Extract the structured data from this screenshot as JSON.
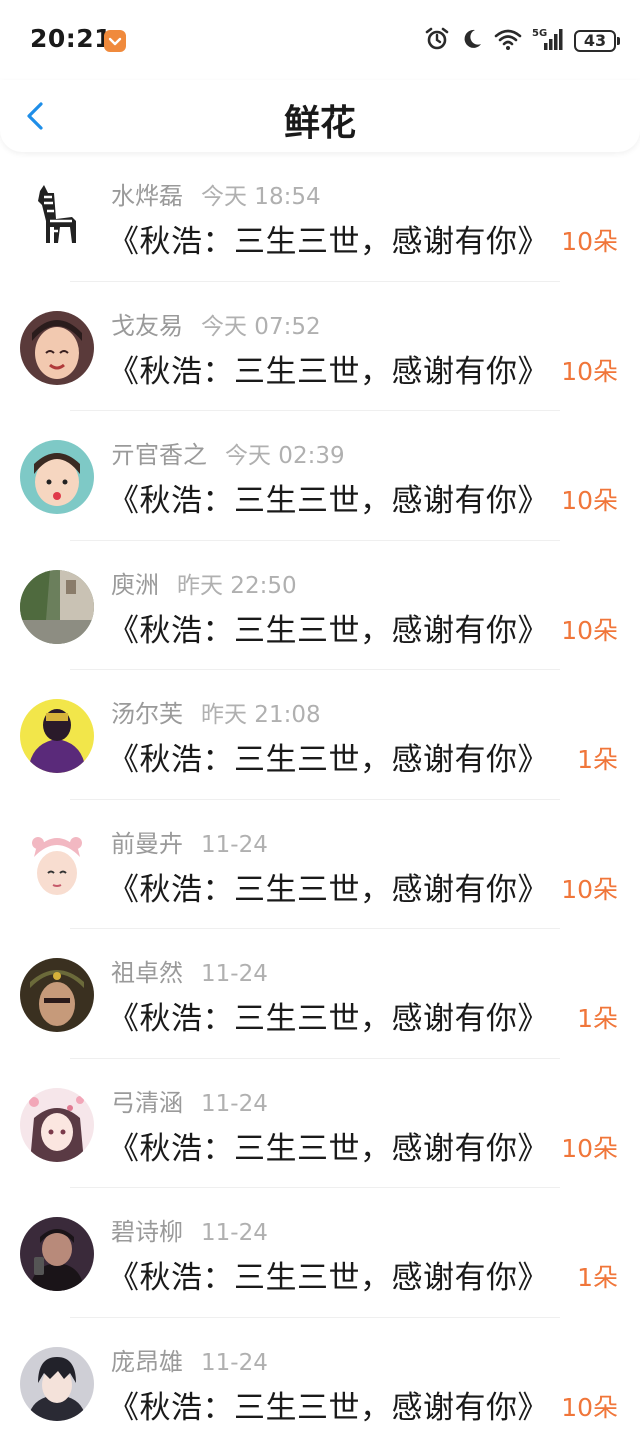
{
  "status_bar": {
    "time": "20:21",
    "battery": "43",
    "network": "5G"
  },
  "nav": {
    "title": "鲜花"
  },
  "colors": {
    "accent": "#f0763a",
    "back": "#1e8ee8"
  },
  "items": [
    {
      "name": "水烨磊",
      "time": "今天 18:54",
      "gift": "《秋浩：三生三世，感谢有你》",
      "count": "10朵"
    },
    {
      "name": "戈友易",
      "time": "今天 07:52",
      "gift": "《秋浩：三生三世，感谢有你》",
      "count": "10朵"
    },
    {
      "name": "亓官香之",
      "time": "今天 02:39",
      "gift": "《秋浩：三生三世，感谢有你》",
      "count": "10朵"
    },
    {
      "name": "庾洲",
      "time": "昨天 22:50",
      "gift": "《秋浩：三生三世，感谢有你》",
      "count": "10朵"
    },
    {
      "name": "汤尔芙",
      "time": "昨天 21:08",
      "gift": "《秋浩：三生三世，感谢有你》",
      "count": "1朵"
    },
    {
      "name": "前曼卉",
      "time": "11-24",
      "gift": "《秋浩：三生三世，感谢有你》",
      "count": "10朵"
    },
    {
      "name": "祖卓然",
      "time": "11-24",
      "gift": "《秋浩：三生三世，感谢有你》",
      "count": "1朵"
    },
    {
      "name": "弓清涵",
      "time": "11-24",
      "gift": "《秋浩：三生三世，感谢有你》",
      "count": "10朵"
    },
    {
      "name": "碧诗柳",
      "time": "11-24",
      "gift": "《秋浩：三生三世，感谢有你》",
      "count": "1朵"
    },
    {
      "name": "庞昂雄",
      "time": "11-24",
      "gift": "《秋浩：三生三世，感谢有你》",
      "count": "10朵"
    }
  ]
}
